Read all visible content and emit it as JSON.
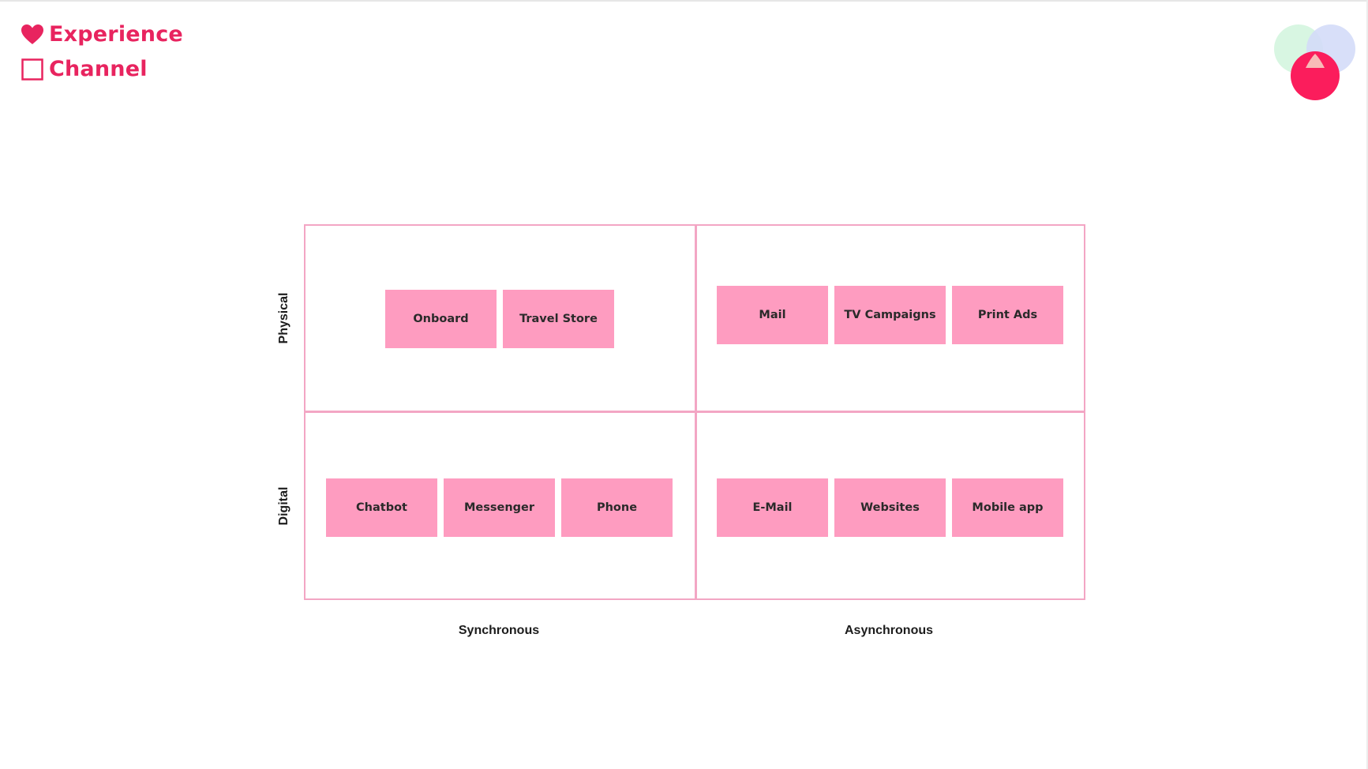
{
  "legend": {
    "experience_label": "Experience",
    "channel_label": "Channel",
    "experience_icon": "heart-icon",
    "channel_icon": "square-outline-icon"
  },
  "colors": {
    "accent": "#e8245f",
    "sticky": "#fe9cc0",
    "grid_line": "#f3a6c4",
    "logo_green": "#d6f5e0",
    "logo_blue": "#d4dcf8",
    "logo_pink": "#fb1d5c"
  },
  "axes": {
    "x": [
      "Synchronous",
      "Asynchronous"
    ],
    "y": [
      "Physical",
      "Digital"
    ]
  },
  "quadrants": {
    "physical_synchronous": [
      "Onboard",
      "Travel Store"
    ],
    "physical_asynchronous": [
      "Mail",
      "TV Campaigns",
      "Print Ads"
    ],
    "digital_synchronous": [
      "Chatbot",
      "Messenger",
      "Phone"
    ],
    "digital_asynchronous": [
      "E-Mail",
      "Websites",
      "Mobile app"
    ]
  }
}
